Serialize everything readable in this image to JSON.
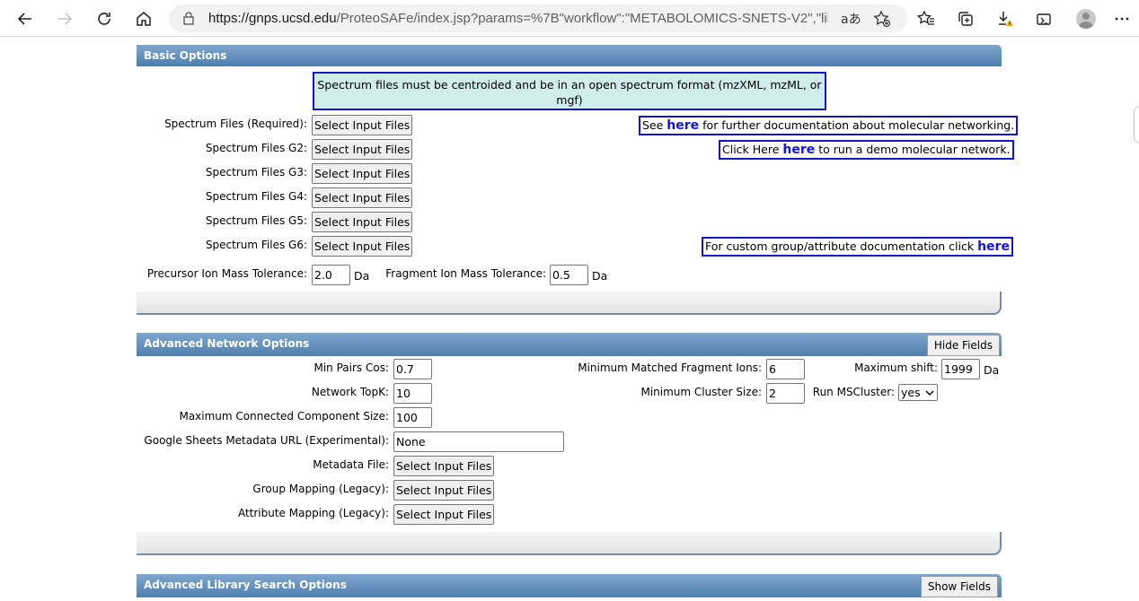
{
  "browser": {
    "url_host": "https://gnps.ucsd.edu",
    "url_path": "/ProteoSAFe/index.jsp?params=%7B\"workflow\":\"METABOLOMICS-SNETS-V2\",\"library_o...",
    "read_aloud_label": "aあ"
  },
  "basic_options": {
    "title": "Basic Options",
    "notice": "Spectrum files must be centroided and be in an open spectrum format (mzXML, mzML, or mgf)",
    "file_button_label": "Select Input Files",
    "spectrum_inputs": [
      {
        "label": "Spectrum Files (Required):"
      },
      {
        "label": "Spectrum Files G2:"
      },
      {
        "label": "Spectrum Files G3:"
      },
      {
        "label": "Spectrum Files G4:"
      },
      {
        "label": "Spectrum Files G5:"
      },
      {
        "label": "Spectrum Files G6:"
      }
    ],
    "doc_link": {
      "prefix": "See ",
      "link": "here",
      "suffix": " for further documentation about molecular networking."
    },
    "demo_link": {
      "prefix": "Click Here ",
      "link": "here",
      "suffix": " to run a demo molecular network."
    },
    "custom_link": {
      "prefix": "For custom group/attribute documentation click ",
      "link": "here"
    },
    "precursor_label": "Precursor Ion Mass Tolerance:",
    "precursor_value": "2.0",
    "precursor_unit": "Da",
    "fragment_label": "Fragment Ion Mass Tolerance:",
    "fragment_value": "0.5",
    "fragment_unit": "Da"
  },
  "advanced_network": {
    "title": "Advanced Network Options",
    "hide_label": "Hide Fields",
    "min_pairs_cos_label": "Min Pairs Cos:",
    "min_pairs_cos": "0.7",
    "network_topk_label": "Network TopK:",
    "network_topk": "10",
    "max_component_label": "Maximum Connected Component Size:",
    "max_component": "100",
    "sheets_label": "Google Sheets Metadata URL (Experimental):",
    "sheets_value": "None",
    "metadata_label": "Metadata File:",
    "group_mapping_label": "Group Mapping (Legacy):",
    "attribute_mapping_label": "Attribute Mapping (Legacy):",
    "file_button_label": "Select Input Files",
    "min_matched_label": "Minimum Matched Fragment Ions:",
    "min_matched": "6",
    "min_cluster_label": "Minimum Cluster Size:",
    "min_cluster": "2",
    "max_shift_label": "Maximum shift:",
    "max_shift": "1999",
    "max_shift_unit": "Da",
    "run_mscluster_label": "Run MSCluster:",
    "run_mscluster": "yes"
  },
  "advanced_library": {
    "title": "Advanced Library Search Options",
    "show_label": "Show Fields"
  }
}
